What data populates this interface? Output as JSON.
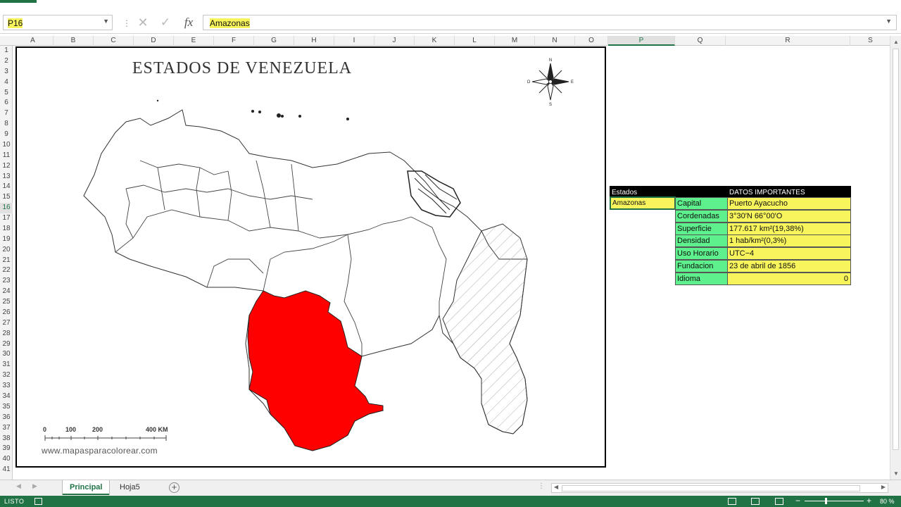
{
  "name_box": {
    "value": "P16"
  },
  "formula_bar": {
    "value": "Amazonas"
  },
  "columns": [
    "A",
    "B",
    "C",
    "D",
    "E",
    "F",
    "G",
    "H",
    "I",
    "J",
    "K",
    "L",
    "M",
    "N",
    "O",
    "P",
    "Q",
    "R",
    "S"
  ],
  "active_column": "P",
  "rows": [
    "1",
    "2",
    "3",
    "4",
    "5",
    "6",
    "7",
    "8",
    "9",
    "10",
    "11",
    "12",
    "13",
    "14",
    "15",
    "16",
    "17",
    "18",
    "19",
    "20",
    "21",
    "22",
    "23",
    "24",
    "25",
    "26",
    "27",
    "28",
    "29",
    "30",
    "31",
    "32",
    "33",
    "34",
    "35",
    "36",
    "37",
    "38",
    "39",
    "40",
    "41"
  ],
  "active_row": "16",
  "map": {
    "title": "ESTADOS DE VENEZUELA",
    "compass_letters": {
      "n": "N",
      "s": "S",
      "e": "E",
      "o": "O"
    },
    "scale_labels": [
      "0",
      "100",
      "200",
      "400 KM"
    ],
    "watermark": "www.mapasparacolorear.com",
    "highlight_color": "#ff0000",
    "highlighted_state": "Amazonas"
  },
  "table": {
    "header_left": "Estados",
    "header_right": "DATOS IMPORTANTES",
    "selected_state": "Amazonas",
    "rows": [
      {
        "label": "Capital",
        "value": "Puerto Ayacucho"
      },
      {
        "label": "Cordenadas",
        "value": "3°30′N 66°00′O"
      },
      {
        "label": "Superficie",
        "value": "177.617 km²(19,38%)"
      },
      {
        "label": "Densidad",
        "value": "1 hab/km²(0,3%)"
      },
      {
        "label": "Uso Horario",
        "value": "UTC−4"
      },
      {
        "label": "Fundacion",
        "value": "23 de abril de 1856"
      },
      {
        "label": "Idioma",
        "value": "0"
      }
    ],
    "label_color": "#5df08c",
    "value_color": "#f8f55c"
  },
  "sheet_tabs": [
    "Principal",
    "Hoja5"
  ],
  "active_tab": "Principal",
  "status": {
    "text": "LISTO",
    "zoom": "80 %"
  },
  "colors": {
    "excel_green": "#217346"
  }
}
